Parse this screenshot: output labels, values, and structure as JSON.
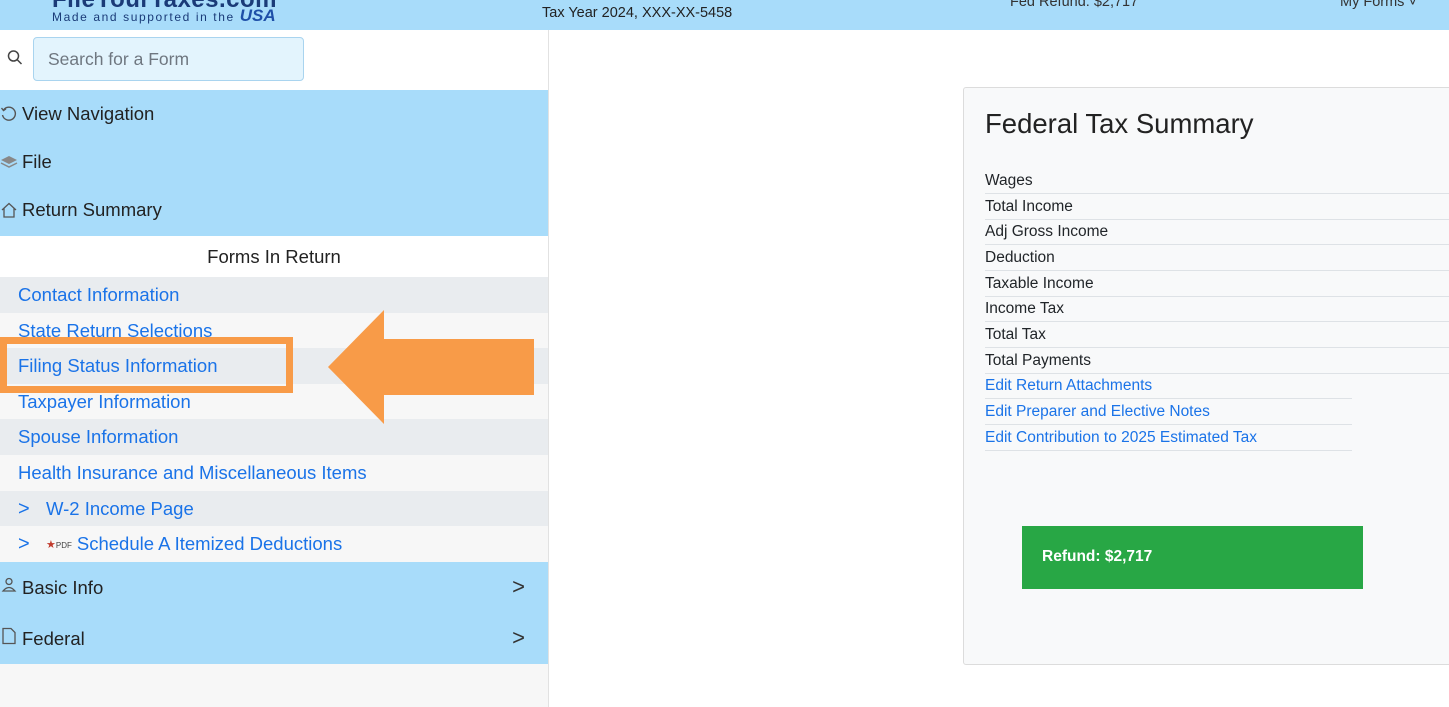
{
  "header": {
    "brand_title": "FileYourTaxes.com",
    "brand_tagline": "Made and supported in the",
    "brand_usa": "USA",
    "tax_year": "Tax Year 2024, XXX-XX-5458",
    "fed_refund": "Fed Refund: $2,717",
    "my_forms": "My Forms ˅"
  },
  "search": {
    "placeholder": "Search for a Form"
  },
  "nav": {
    "view_navigation": "View Navigation",
    "file": "File",
    "return_summary": "Return Summary"
  },
  "forms_in_return": {
    "title": "Forms In Return",
    "items": [
      "Contact Information",
      "State Return Selections",
      "Filing Status Information",
      "Taxpayer Information",
      "Spouse Information",
      "Health Insurance and Miscellaneous Items",
      "W-2 Income Page",
      "Schedule A Itemized Deductions"
    ],
    "chevron": ">",
    "pdf_label": "PDF"
  },
  "bottom_nav": {
    "basic_info": "Basic Info",
    "federal": "Federal",
    "chevron": ">"
  },
  "summary": {
    "title": "Federal Tax Summary",
    "rows": [
      "Wages",
      "Total Income",
      "Adj Gross Income",
      "Deduction",
      "Taxable Income",
      "Income Tax",
      "Total Tax",
      "Total Payments"
    ],
    "links": [
      "Edit Return Attachments",
      "Edit Preparer and Elective Notes",
      "Edit Contribution to 2025 Estimated Tax"
    ],
    "refund": "Refund: $2,717"
  },
  "colors": {
    "header_bg": "#a8dcfa",
    "link": "#1a73e8",
    "highlight": "#f89b48",
    "refund_bg": "#28a745"
  }
}
